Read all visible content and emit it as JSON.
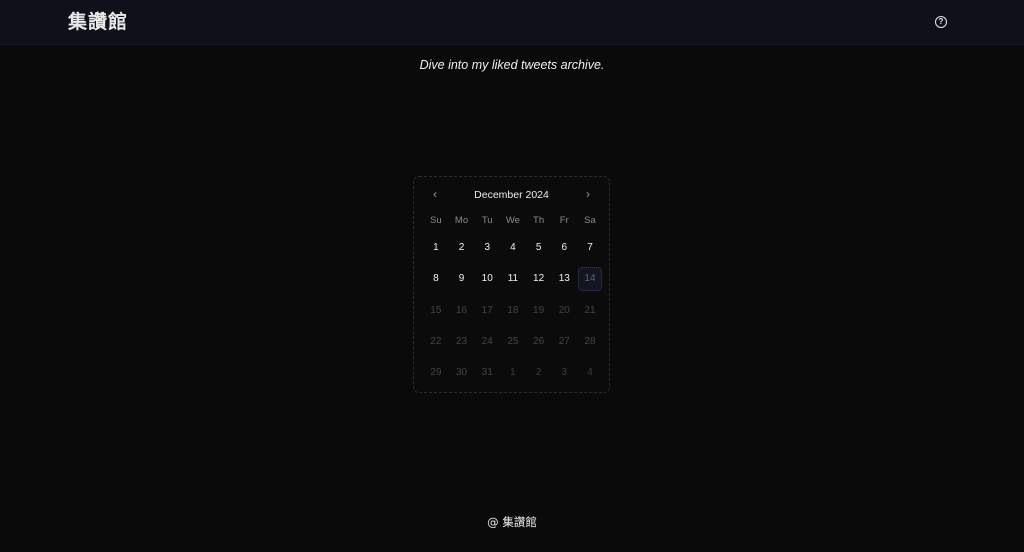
{
  "header": {
    "brand": "集讚館",
    "help_icon_glyph": "?"
  },
  "tagline": "Dive into my liked tweets archive.",
  "calendar": {
    "month_label": "December 2024",
    "prev_glyph": "‹",
    "next_glyph": "›",
    "weekdays": [
      "Su",
      "Mo",
      "Tu",
      "We",
      "Th",
      "Fr",
      "Sa"
    ],
    "days": [
      {
        "label": "1",
        "state": "enabled"
      },
      {
        "label": "2",
        "state": "enabled"
      },
      {
        "label": "3",
        "state": "enabled"
      },
      {
        "label": "4",
        "state": "enabled"
      },
      {
        "label": "5",
        "state": "enabled"
      },
      {
        "label": "6",
        "state": "enabled"
      },
      {
        "label": "7",
        "state": "enabled"
      },
      {
        "label": "8",
        "state": "enabled"
      },
      {
        "label": "9",
        "state": "enabled"
      },
      {
        "label": "10",
        "state": "enabled"
      },
      {
        "label": "11",
        "state": "enabled"
      },
      {
        "label": "12",
        "state": "enabled"
      },
      {
        "label": "13",
        "state": "enabled"
      },
      {
        "label": "14",
        "state": "today"
      },
      {
        "label": "15",
        "state": "disabled"
      },
      {
        "label": "16",
        "state": "disabled"
      },
      {
        "label": "17",
        "state": "disabled"
      },
      {
        "label": "18",
        "state": "disabled"
      },
      {
        "label": "19",
        "state": "disabled"
      },
      {
        "label": "20",
        "state": "disabled"
      },
      {
        "label": "21",
        "state": "disabled"
      },
      {
        "label": "22",
        "state": "disabled"
      },
      {
        "label": "23",
        "state": "disabled"
      },
      {
        "label": "24",
        "state": "disabled"
      },
      {
        "label": "25",
        "state": "disabled"
      },
      {
        "label": "26",
        "state": "disabled"
      },
      {
        "label": "27",
        "state": "disabled"
      },
      {
        "label": "28",
        "state": "disabled"
      },
      {
        "label": "29",
        "state": "disabled"
      },
      {
        "label": "30",
        "state": "disabled"
      },
      {
        "label": "31",
        "state": "disabled"
      },
      {
        "label": "1",
        "state": "outside"
      },
      {
        "label": "2",
        "state": "outside"
      },
      {
        "label": "3",
        "state": "outside"
      },
      {
        "label": "4",
        "state": "outside"
      }
    ]
  },
  "footer": {
    "text": "@ 集讚館"
  },
  "colors": {
    "background": "#0a0a0a",
    "header_background": "#0e111a",
    "today_highlight": "#121522"
  }
}
